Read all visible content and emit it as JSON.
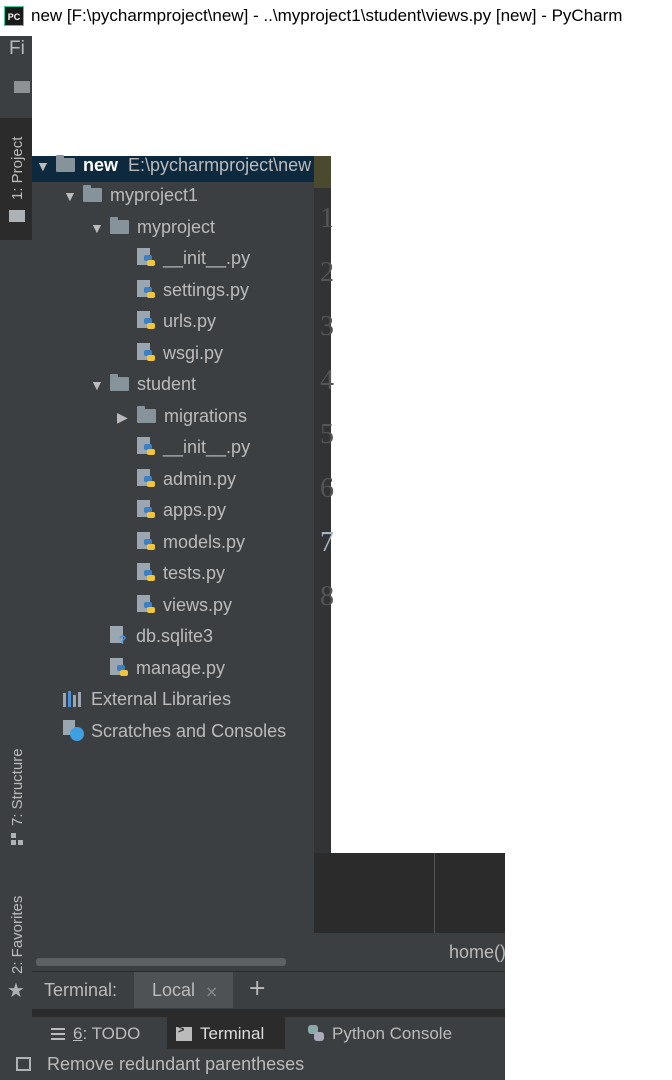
{
  "window": {
    "title": "new [F:\\pycharmproject\\new] - ..\\myproject1\\student\\views.py [new] - PyCharm",
    "logo_text": "PC"
  },
  "menu": {
    "first_item": "Fi"
  },
  "side_tabs": {
    "project": "1: Project",
    "structure": "7: Structure",
    "favorites": "2: Favorites"
  },
  "project_tree": {
    "root": {
      "name": "new",
      "path": "E:\\pycharmproject\\new"
    },
    "rows": [
      {
        "label": "myproject1",
        "indent": 1,
        "kind": "folder",
        "expanded": true
      },
      {
        "label": "myproject",
        "indent": 2,
        "kind": "folder",
        "expanded": true
      },
      {
        "label": "__init__.py",
        "indent": 3,
        "kind": "py"
      },
      {
        "label": "settings.py",
        "indent": 3,
        "kind": "py"
      },
      {
        "label": "urls.py",
        "indent": 3,
        "kind": "py"
      },
      {
        "label": "wsgi.py",
        "indent": 3,
        "kind": "py"
      },
      {
        "label": "student",
        "indent": 2,
        "kind": "folder",
        "expanded": true
      },
      {
        "label": "migrations",
        "indent": 3,
        "kind": "folder",
        "expanded": false
      },
      {
        "label": "__init__.py",
        "indent": 3,
        "kind": "py"
      },
      {
        "label": "admin.py",
        "indent": 3,
        "kind": "py"
      },
      {
        "label": "apps.py",
        "indent": 3,
        "kind": "py"
      },
      {
        "label": "models.py",
        "indent": 3,
        "kind": "py"
      },
      {
        "label": "tests.py",
        "indent": 3,
        "kind": "py"
      },
      {
        "label": "views.py",
        "indent": 3,
        "kind": "py"
      },
      {
        "label": "db.sqlite3",
        "indent": 2,
        "kind": "db"
      },
      {
        "label": "manage.py",
        "indent": 2,
        "kind": "py"
      },
      {
        "label": "External Libraries",
        "indent": 1,
        "kind": "lib"
      },
      {
        "label": "Scratches and Consoles",
        "indent": 1,
        "kind": "scratch"
      }
    ]
  },
  "editor": {
    "line_numbers": [
      "1",
      "2",
      "3",
      "4",
      "5",
      "6",
      "7",
      "8"
    ],
    "breadcrumb": "home()"
  },
  "terminal": {
    "label": "Terminal:",
    "tab": "Local",
    "close_symbol": "×",
    "add_symbol": "+"
  },
  "bottom_tabs": {
    "todo_key": "6",
    "todo_rest": ": TODO",
    "terminal": "Terminal",
    "python_console": "Python Console"
  },
  "status": {
    "message": "Remove redundant parentheses"
  }
}
